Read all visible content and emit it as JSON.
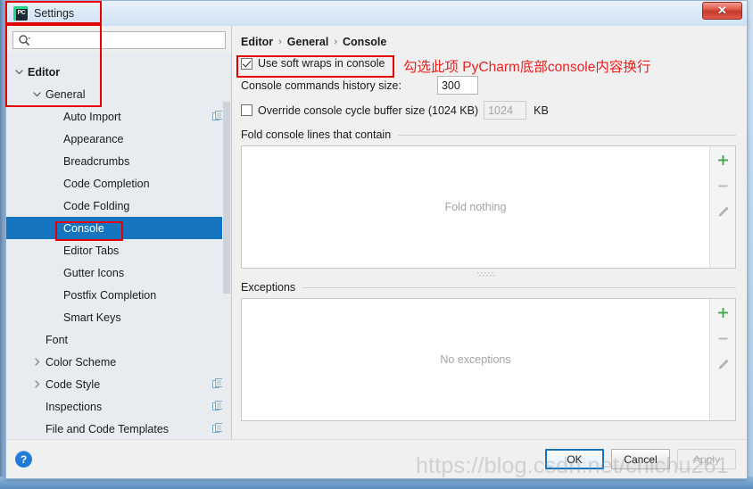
{
  "window": {
    "title": "Settings",
    "app_icon": "pycharm-icon",
    "icon_text": "PC",
    "close_label": "✕"
  },
  "search": {
    "value": "",
    "placeholder": "",
    "icon": "search-icon"
  },
  "tree": {
    "partial_top_row": "",
    "items": [
      {
        "label": "Editor",
        "indent": 0,
        "twisty": "down",
        "bold": true,
        "selected": false,
        "copy": false
      },
      {
        "label": "General",
        "indent": 1,
        "twisty": "down",
        "bold": false,
        "selected": false,
        "copy": false
      },
      {
        "label": "Auto Import",
        "indent": 2,
        "twisty": "none",
        "bold": false,
        "selected": false,
        "copy": true
      },
      {
        "label": "Appearance",
        "indent": 2,
        "twisty": "none",
        "bold": false,
        "selected": false,
        "copy": false
      },
      {
        "label": "Breadcrumbs",
        "indent": 2,
        "twisty": "none",
        "bold": false,
        "selected": false,
        "copy": false
      },
      {
        "label": "Code Completion",
        "indent": 2,
        "twisty": "none",
        "bold": false,
        "selected": false,
        "copy": false
      },
      {
        "label": "Code Folding",
        "indent": 2,
        "twisty": "none",
        "bold": false,
        "selected": false,
        "copy": false
      },
      {
        "label": "Console",
        "indent": 2,
        "twisty": "none",
        "bold": false,
        "selected": true,
        "copy": false
      },
      {
        "label": "Editor Tabs",
        "indent": 2,
        "twisty": "none",
        "bold": false,
        "selected": false,
        "copy": false
      },
      {
        "label": "Gutter Icons",
        "indent": 2,
        "twisty": "none",
        "bold": false,
        "selected": false,
        "copy": false
      },
      {
        "label": "Postfix Completion",
        "indent": 2,
        "twisty": "none",
        "bold": false,
        "selected": false,
        "copy": false
      },
      {
        "label": "Smart Keys",
        "indent": 2,
        "twisty": "none",
        "bold": false,
        "selected": false,
        "copy": false
      },
      {
        "label": "Font",
        "indent": 1,
        "twisty": "none",
        "bold": false,
        "selected": false,
        "copy": false
      },
      {
        "label": "Color Scheme",
        "indent": 1,
        "twisty": "right",
        "bold": false,
        "selected": false,
        "copy": false
      },
      {
        "label": "Code Style",
        "indent": 1,
        "twisty": "right",
        "bold": false,
        "selected": false,
        "copy": true
      },
      {
        "label": "Inspections",
        "indent": 1,
        "twisty": "none",
        "bold": false,
        "selected": false,
        "copy": true
      },
      {
        "label": "File and Code Templates",
        "indent": 1,
        "twisty": "none",
        "bold": false,
        "selected": false,
        "copy": true
      }
    ]
  },
  "breadcrumb": {
    "part1": "Editor",
    "sep1": "›",
    "part2": "General",
    "sep2": "›",
    "part3": "Console"
  },
  "settings": {
    "soft_wraps": {
      "label": "Use soft wraps in console",
      "checked": true
    },
    "history": {
      "label": "Console commands history size:",
      "value": "300"
    },
    "override_buffer": {
      "label": "Override console cycle buffer size (1024 KB)",
      "value": "1024",
      "unit": "KB",
      "checked": false,
      "disabled": true
    }
  },
  "fold_section": {
    "title": "Fold console lines that contain",
    "empty_text": "Fold nothing",
    "toolbar": [
      {
        "name": "add-icon",
        "glyph": "+"
      },
      {
        "name": "remove-icon",
        "glyph": "−"
      },
      {
        "name": "edit-icon",
        "glyph": "✎"
      }
    ]
  },
  "exceptions_section": {
    "title": "Exceptions",
    "empty_text": "No exceptions",
    "toolbar": [
      {
        "name": "add-icon",
        "glyph": "+"
      },
      {
        "name": "remove-icon",
        "glyph": "−"
      },
      {
        "name": "edit-icon",
        "glyph": "✎"
      }
    ]
  },
  "footer": {
    "help": "?",
    "ok": "OK",
    "cancel": "Cancel",
    "apply": "Apply"
  },
  "annotations": {
    "note": "勾选此项  PyCharm底部console内容换行",
    "color": "#ef2020"
  },
  "watermark": {
    "text": "https://blog.csdn.net/chichu261"
  },
  "colors": {
    "selection_blue": "#1675c0",
    "annotation_red": "#e60000",
    "accent_green": "#3ea34a",
    "panel_bg": "#f0f0f0",
    "tree_bg": "#e8ecf0"
  }
}
